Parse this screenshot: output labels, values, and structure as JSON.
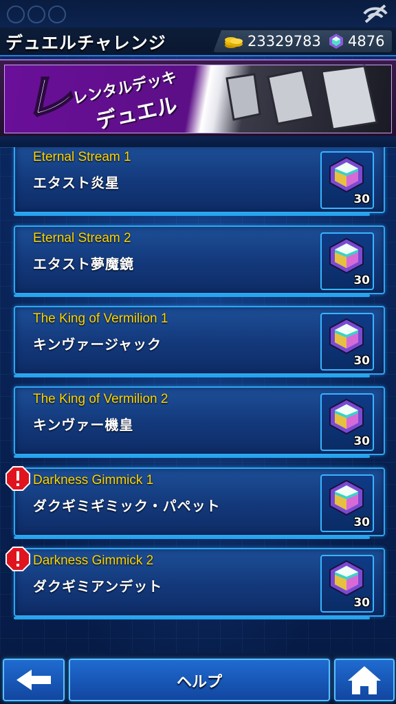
{
  "header": {
    "title": "デュエルチャレンジ",
    "gold": "23329783",
    "gems": "4876"
  },
  "banner": {
    "line1": "レンタルデッキ",
    "line2": "デュエル"
  },
  "duels": [
    {
      "title": "Eternal Stream 1",
      "subtitle": "エタスト炎星",
      "reward": "30",
      "alert": false
    },
    {
      "title": "Eternal Stream 2",
      "subtitle": "エタスト夢魔鏡",
      "reward": "30",
      "alert": false
    },
    {
      "title": "The King of Vermilion 1",
      "subtitle": "キンヴァージャック",
      "reward": "30",
      "alert": false
    },
    {
      "title": "The King of Vermilion 2",
      "subtitle": "キンヴァー機皇",
      "reward": "30",
      "alert": false
    },
    {
      "title": "Darkness Gimmick 1",
      "subtitle": "ダクギミギミック・パペット",
      "reward": "30",
      "alert": true
    },
    {
      "title": "Darkness Gimmick 2",
      "subtitle": "ダクギミアンデット",
      "reward": "30",
      "alert": true
    }
  ],
  "footer": {
    "help_label": "ヘルプ"
  },
  "colors": {
    "title_yellow": "#ffd400",
    "frame_blue": "#2fa7f0",
    "banner_purple": "#6a0f9a",
    "alert_red": "#e0141e"
  },
  "icons": {
    "back": "back-arrow-icon",
    "home": "home-icon",
    "gem": "gem-icon",
    "coin": "coin-stack-icon",
    "alert": "alert-icon",
    "disconnect": "connection-icon"
  }
}
